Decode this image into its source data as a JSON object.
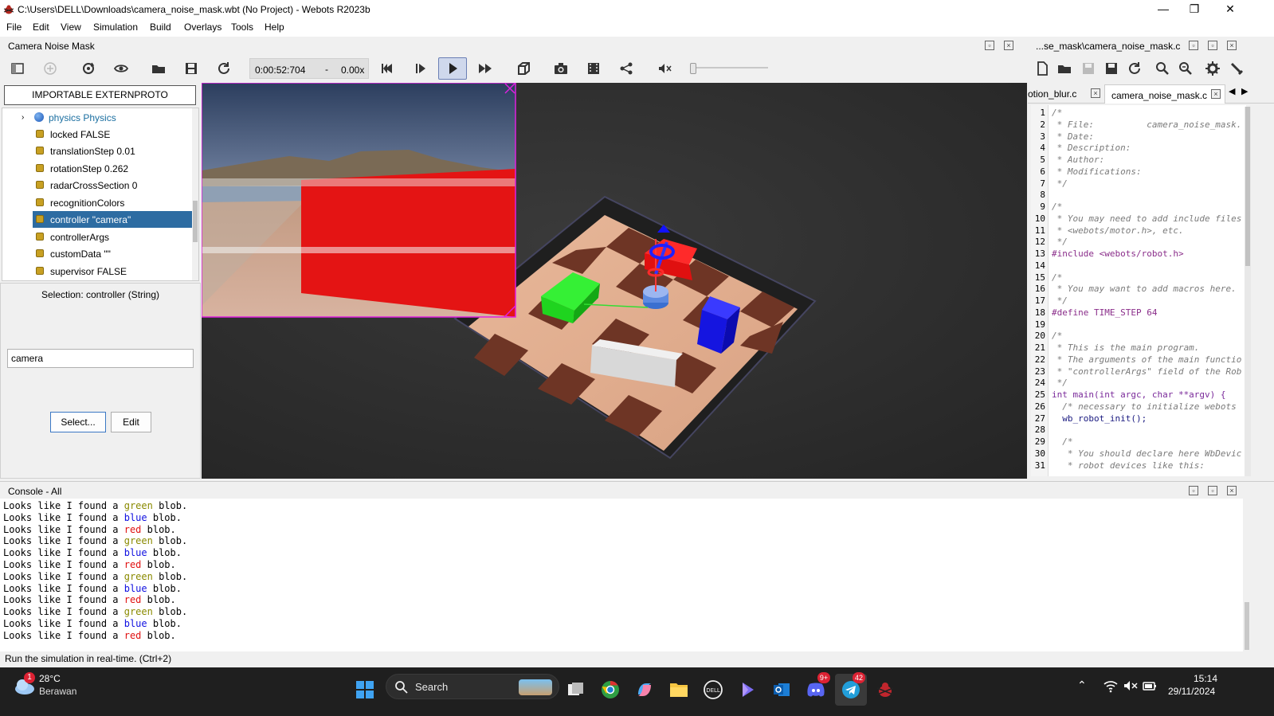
{
  "window": {
    "title": "C:\\Users\\DELL\\Downloads\\camera_noise_mask.wbt (No Project) - Webots R2023b",
    "minimize": "—",
    "maximize": "❐",
    "close": "✕"
  },
  "menu": [
    "File",
    "Edit",
    "View",
    "Simulation",
    "Build",
    "Overlays",
    "Tools",
    "Help"
  ],
  "scene_panel": {
    "title": "Camera Noise Mask"
  },
  "toolbar": {
    "time": "0:00:52:704",
    "dash": "-",
    "speed": "0.00x"
  },
  "scene_tree": {
    "import_button": "IMPORTABLE EXTERNPROTO",
    "physics_label": "physics Physics",
    "items": [
      "locked FALSE",
      "translationStep 0.01",
      "rotationStep 0.262",
      "radarCrossSection 0",
      "recognitionColors",
      "controller \"camera\"",
      "controllerArgs",
      "customData \"\"",
      "supervisor FALSE"
    ],
    "selected_index": 5
  },
  "field_editor": {
    "selection_label": "Selection: controller (String)",
    "value": "camera",
    "select_button": "Select...",
    "edit_button": "Edit"
  },
  "editor": {
    "title": "...se_mask\\camera_noise_mask.c",
    "tabs": [
      "otion_blur.c",
      "camera_noise_mask.c"
    ],
    "active_tab": 1,
    "line_numbers": [
      "1",
      "2",
      "3",
      "4",
      "5",
      "6",
      "7",
      "8",
      "9",
      "10",
      "11",
      "12",
      "13",
      "14",
      "15",
      "16",
      "17",
      "18",
      "19",
      "20",
      "21",
      "22",
      "23",
      "24",
      "25",
      "26",
      "27",
      "28",
      "29",
      "30",
      "31"
    ],
    "lines": [
      "/*",
      " * File:          camera_noise_mask.",
      " * Date:",
      " * Description:",
      " * Author:",
      " * Modifications:",
      " */",
      "",
      "/*",
      " * You may need to add include files",
      " * <webots/motor.h>, etc.",
      " */",
      "#include <webots/robot.h>",
      "",
      "/*",
      " * You may want to add macros here.",
      " */",
      "#define TIME_STEP 64",
      "",
      "/*",
      " * This is the main program.",
      " * The arguments of the main functio",
      " * \"controllerArgs\" field of the Rob",
      " */",
      "int main(int argc, char **argv) {",
      "  /* necessary to initialize webots",
      "  wb_robot_init();",
      "",
      "  /*",
      "   * You should declare here WbDevic",
      "   * robot devices like this:"
    ]
  },
  "console": {
    "title": "Console - All",
    "prefix": "Looks like I found a",
    "suffix": "blob.",
    "colors": [
      "green",
      "blue",
      "red",
      "green",
      "blue",
      "red",
      "green",
      "blue",
      "red",
      "green",
      "blue",
      "red"
    ],
    "color_hex": {
      "green": "#8a8a00",
      "blue": "#1010e0",
      "red": "#e01010"
    }
  },
  "status": {
    "text": "Run the simulation in real-time. (Ctrl+2)"
  },
  "taskbar": {
    "temperature": "28°C",
    "weather": "Berawan",
    "weather_badge": "1",
    "search": "Search",
    "discord_badge": "9+",
    "telegram_badge": "42",
    "time": "15:14",
    "date": "29/11/2024"
  }
}
